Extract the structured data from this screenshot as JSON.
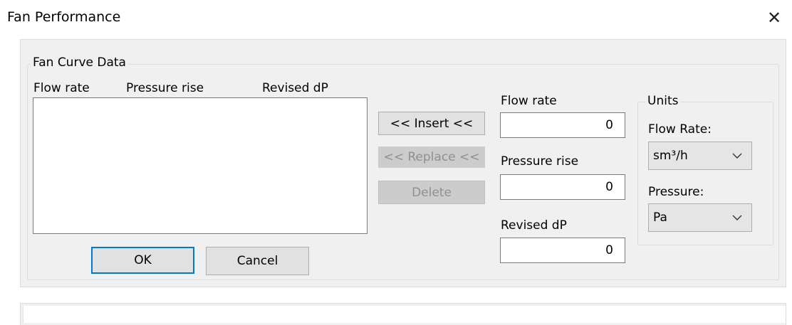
{
  "window": {
    "title": "Fan Performance",
    "close_glyph": "✕"
  },
  "fan_curve": {
    "group_title": "Fan Curve Data",
    "columns": [
      "Flow rate",
      "Pressure rise",
      "Revised dP"
    ],
    "rows": []
  },
  "actions": {
    "insert": "<< Insert <<",
    "replace": "<< Replace <<",
    "delete": "Delete",
    "ok": "OK",
    "cancel": "Cancel"
  },
  "entry": {
    "flow_rate_label": "Flow rate",
    "flow_rate_value": "0",
    "pressure_rise_label": "Pressure rise",
    "pressure_rise_value": "0",
    "revised_dp_label": "Revised dP",
    "revised_dp_value": "0"
  },
  "units": {
    "group_title": "Units",
    "flow_rate_label": "Flow Rate:",
    "flow_rate_selected": "sm³/h",
    "pressure_label": "Pressure:",
    "pressure_selected": "Pa"
  }
}
